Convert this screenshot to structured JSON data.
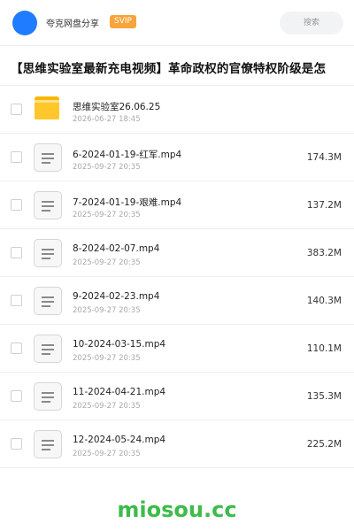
{
  "header": {
    "username": "夸克网盘分享",
    "badge": "SVIP",
    "search_placeholder": "搜索"
  },
  "share": {
    "title": "【思维实验室最新充电视频】革命政权的官僚特权阶级是怎"
  },
  "files": [
    {
      "type": "folder",
      "icon": "folder-icon",
      "name": "思维实验室26.06.25",
      "date": "2026-06-27 18:45",
      "size": ""
    },
    {
      "type": "file",
      "icon": "document-icon",
      "name": "6-2024-01-19-红军.mp4",
      "date": "2025-09-27 20:35",
      "size": "174.3M"
    },
    {
      "type": "file",
      "icon": "document-icon",
      "name": "7-2024-01-19-艰难.mp4",
      "date": "2025-09-27 20:35",
      "size": "137.2M"
    },
    {
      "type": "file",
      "icon": "document-icon",
      "name": "8-2024-02-07.mp4",
      "date": "2025-09-27 20:35",
      "size": "383.2M"
    },
    {
      "type": "file",
      "icon": "document-icon",
      "name": "9-2024-02-23.mp4",
      "date": "2025-09-27 20:35",
      "size": "140.3M"
    },
    {
      "type": "file",
      "icon": "document-icon",
      "name": "10-2024-03-15.mp4",
      "date": "2025-09-27 20:35",
      "size": "110.1M"
    },
    {
      "type": "file",
      "icon": "document-icon",
      "name": "11-2024-04-21.mp4",
      "date": "2025-09-27 20:35",
      "size": "135.3M"
    },
    {
      "type": "file",
      "icon": "document-icon",
      "name": "12-2024-05-24.mp4",
      "date": "2025-09-27 20:35",
      "size": "225.2M"
    }
  ],
  "watermark": "miosou.cc",
  "colors": {
    "accent": "#1f7cff",
    "svip": "#f7a43a",
    "folder": "#ffc72c",
    "watermark": "#3dbb4a"
  }
}
